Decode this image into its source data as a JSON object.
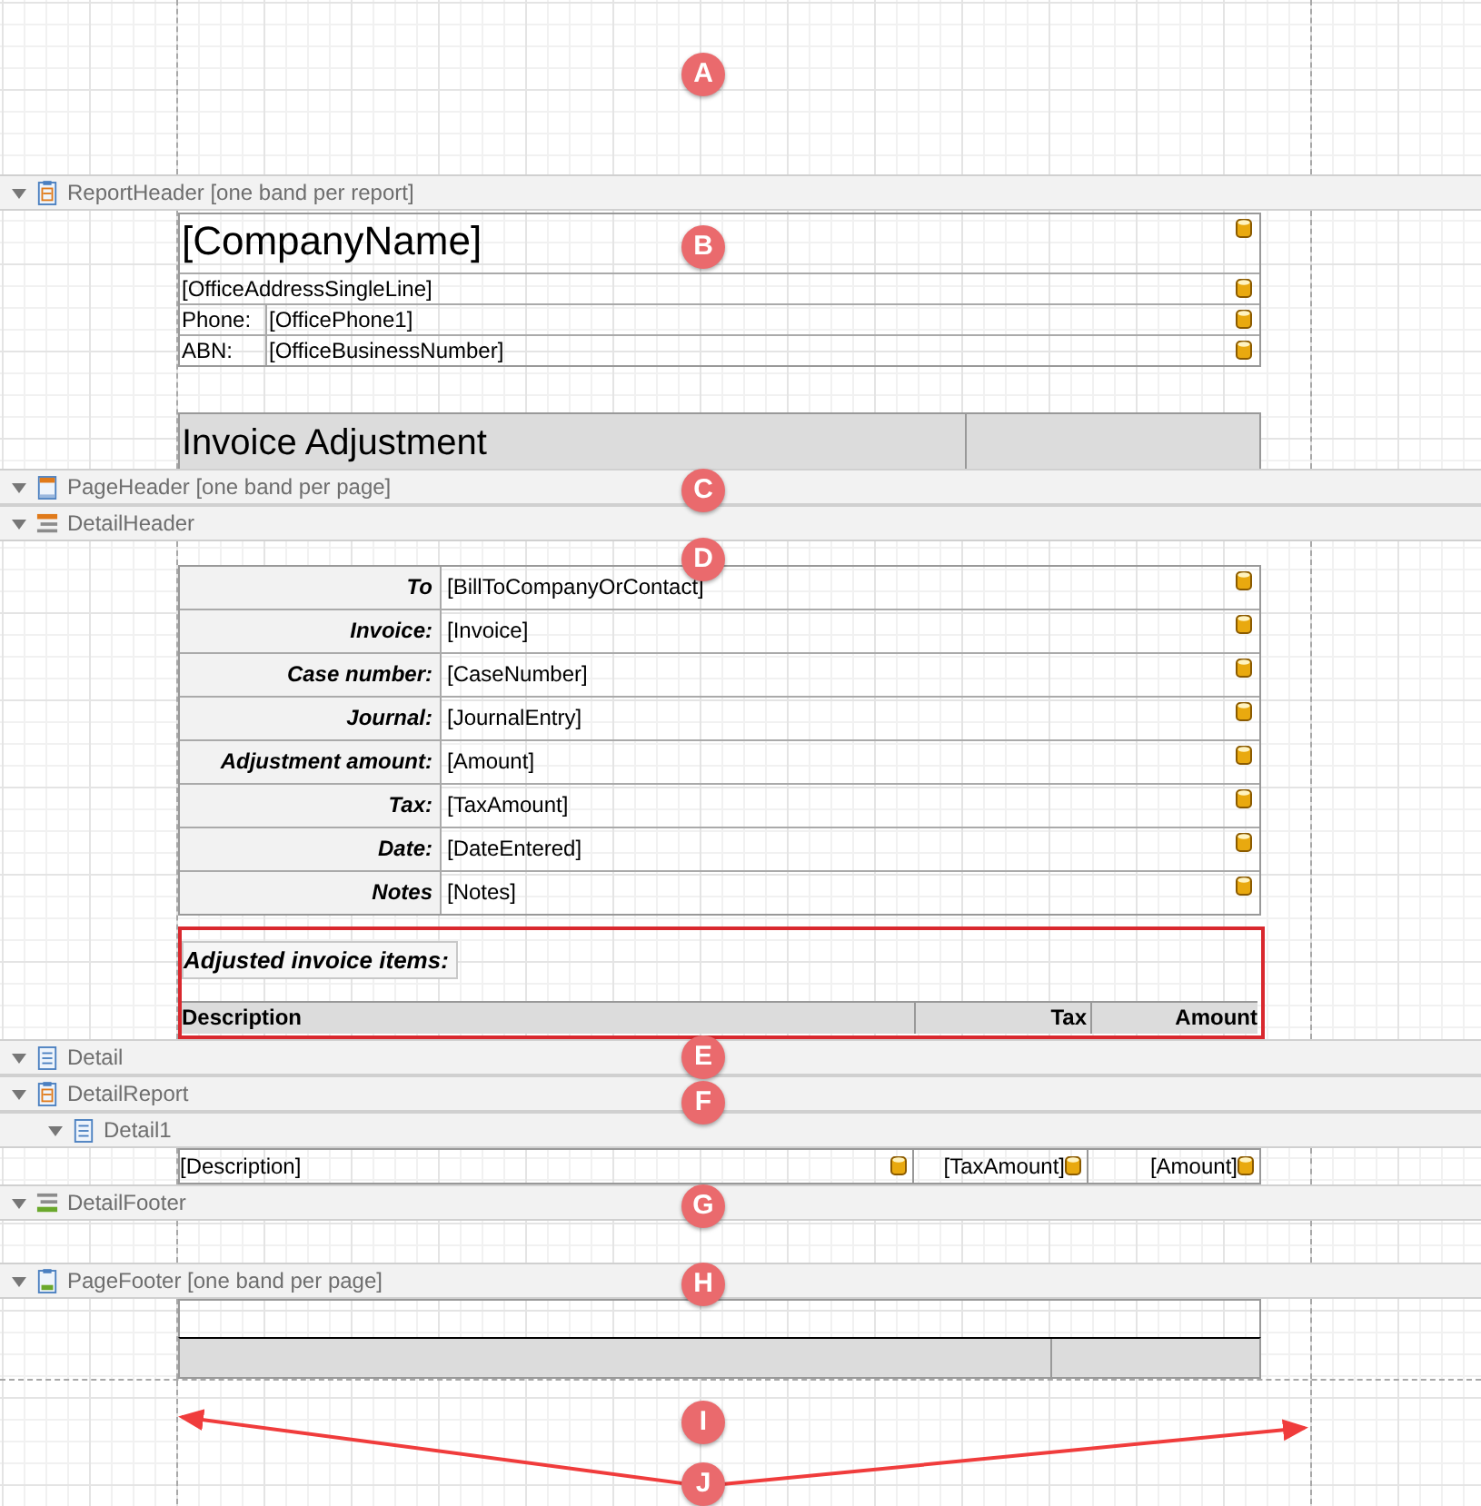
{
  "sections": [
    {
      "kind": "margin",
      "markers": [
        "A"
      ]
    },
    {
      "kind": "report_band",
      "title": "ReportHeader [one band per report]",
      "expanded": true
    },
    {
      "kind": "report_header",
      "marker": "B",
      "company": "[CompanyName]",
      "address": "[OfficeAddressSingleLine]",
      "lines": [
        {
          "label": "Phone:",
          "value": "[OfficePhone1]"
        },
        {
          "label": "ABN:",
          "value": "[OfficeBusinessNumber]"
        }
      ],
      "title": "Invoice Adjustment"
    },
    {
      "kind": "page_header_band",
      "title": "PageHeader [one band per page]",
      "expanded": true,
      "marker": "C"
    },
    {
      "kind": "group_header_band",
      "title": "DetailHeader",
      "expanded": true
    },
    {
      "kind": "detail_header",
      "marker": "D",
      "fields": [
        {
          "label": "To",
          "value": "[BillToCompanyOrContact]"
        },
        {
          "label": "Invoice:",
          "value": "[Invoice]"
        },
        {
          "label": "Case number:",
          "value": "[CaseNumber]"
        },
        {
          "label": "Journal:",
          "value": "[JournalEntry]"
        },
        {
          "label": "Adjustment amount:",
          "value": "[Amount]"
        },
        {
          "label": "Tax:",
          "value": "[TaxAmount]"
        },
        {
          "label": "Date:",
          "value": "[DateEntered]"
        },
        {
          "label": "Notes",
          "value": "[Notes]"
        }
      ],
      "subtitle": "Adjusted invoice items:",
      "highlighted": true,
      "columns": [
        "Description",
        "Tax",
        "Amount"
      ]
    },
    {
      "kind": "detail_band",
      "title": "Detail",
      "expanded": true,
      "marker": "E"
    },
    {
      "kind": "report_band",
      "title": "DetailReport",
      "expanded": true,
      "marker": "F",
      "children": [
        {
          "kind": "detail_band",
          "title": "Detail1",
          "expanded": true
        },
        {
          "kind": "detail_row",
          "cells": [
            "[Description]",
            "[TaxAmount]",
            "[Amount]"
          ]
        }
      ]
    },
    {
      "kind": "group_footer_band",
      "title": "DetailFooter",
      "expanded": true,
      "marker": "G"
    },
    {
      "kind": "empty"
    },
    {
      "kind": "page_footer_band",
      "title": "PageFooter [one band per page]",
      "expanded": true,
      "marker": "H"
    },
    {
      "kind": "page_footer"
    },
    {
      "kind": "margin",
      "markers": [
        "I",
        "J"
      ]
    }
  ]
}
